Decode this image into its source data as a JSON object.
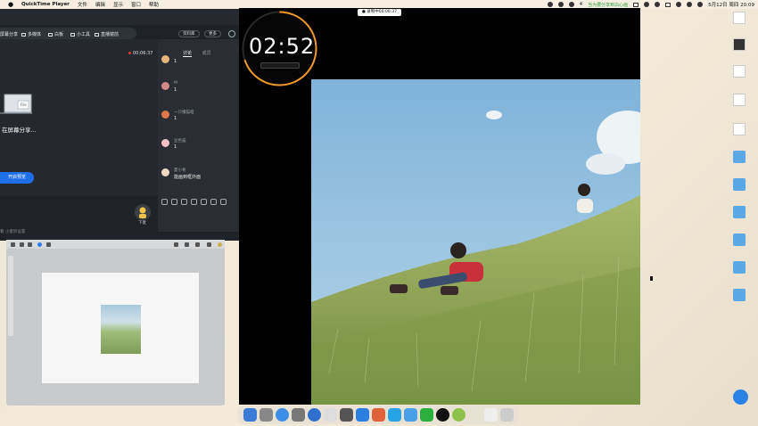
{
  "menubar": {
    "app_name": "QuickTime Player",
    "items": [
      "文件",
      "编辑",
      "显示",
      "窗口",
      "帮助"
    ],
    "status_text": "当为要分享到白心画",
    "date_time": "5月12日 周四 20:09",
    "wechat_badge": "4"
  },
  "meeting": {
    "toolbar": [
      {
        "label": "屏幕分享",
        "icon": "screen-share-icon"
      },
      {
        "label": "多媒体",
        "icon": "media-icon"
      },
      {
        "label": "白板",
        "icon": "whiteboard-icon"
      },
      {
        "label": "小工具",
        "icon": "tools-icon"
      },
      {
        "label": "直播镜前",
        "icon": "camera-icon"
      }
    ],
    "top_buttons": [
      "资料库",
      "更多"
    ],
    "recording_time": "00:06:37",
    "share_text": "在屏幕分享...",
    "share_art_label": "File",
    "start_button": "开启预览",
    "host_label": "下麦",
    "bottom_left_text": "看   小麦听设置",
    "chat": {
      "tabs": [
        "讨论",
        "成员"
      ],
      "messages": [
        {
          "name": "",
          "text": "1",
          "avatar_color": "#e8b47a"
        },
        {
          "name": "M",
          "text": "1",
          "avatar_color": "#d48a8a"
        },
        {
          "name": "一只懂猫喵",
          "text": "1",
          "avatar_color": "#e0774a"
        },
        {
          "name": "豆色猫",
          "text": "1",
          "avatar_color": "#f2c1c8"
        },
        {
          "name": "夏小希",
          "text": "能画到框外面",
          "avatar_color": "#f0d8c8"
        }
      ]
    }
  },
  "video": {
    "recording_pill": "● 录制中00:06:37",
    "timer": "02:52"
  },
  "desktop": {
    "icons": [
      {
        "label": "",
        "kind": "file"
      },
      {
        "label": "",
        "kind": "file"
      },
      {
        "label": "",
        "kind": "file"
      },
      {
        "label": "",
        "kind": "file"
      },
      {
        "label": "",
        "kind": "file"
      },
      {
        "label": "",
        "kind": "folder"
      },
      {
        "label": "",
        "kind": "folder"
      },
      {
        "label": "",
        "kind": "folder"
      },
      {
        "label": "",
        "kind": "folder"
      },
      {
        "label": "",
        "kind": "folder"
      },
      {
        "label": "",
        "kind": "folder"
      }
    ]
  },
  "colors": {
    "meeting_bg": "#1f2328",
    "accent_blue": "#1f6fe6",
    "timer_ring": "#f0962a",
    "record_red": "#e33"
  }
}
